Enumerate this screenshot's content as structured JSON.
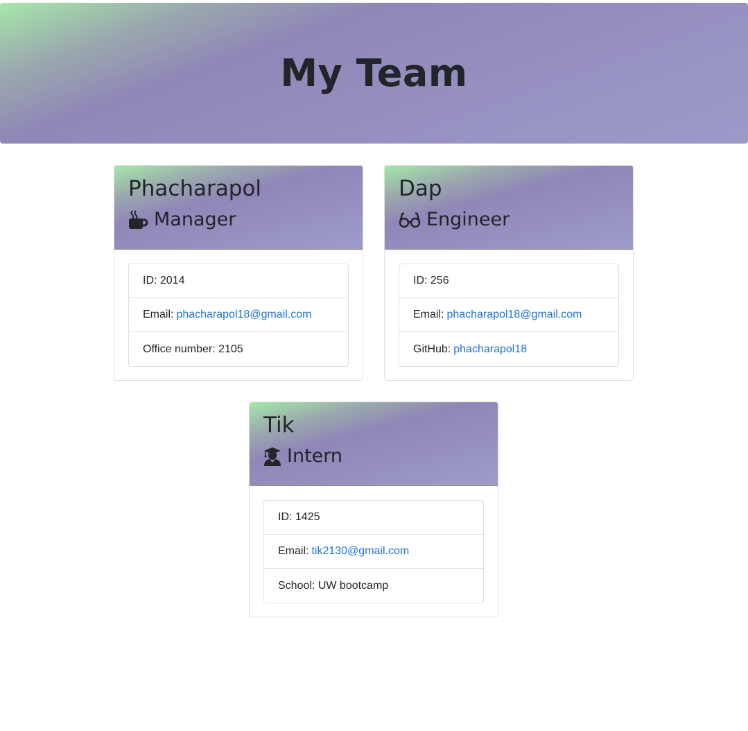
{
  "header": {
    "title": "My Team"
  },
  "cards": [
    {
      "name": "Phacharapol",
      "role": "Manager",
      "icon": "coffee-icon",
      "id_label": "ID: 2014",
      "email_label": "Email:",
      "email": "phacharapol18@gmail.com",
      "extra_label": "Office number: 2105"
    },
    {
      "name": "Dap",
      "role": "Engineer",
      "icon": "glasses-icon",
      "id_label": "ID: 256",
      "email_label": "Email:",
      "email": "phacharapol18@gmail.com",
      "extra_label": "GitHub:",
      "extra_link": "phacharapol18"
    },
    {
      "name": "Tik",
      "role": "Intern",
      "icon": "graduate-icon",
      "id_label": "ID: 1425",
      "email_label": "Email:",
      "email": "tik2130@gmail.com",
      "extra_label": "School: UW bootcamp"
    }
  ],
  "colors": {
    "gradient_green": "#a6e8a9",
    "gradient_purple": "#8f87b7",
    "link": "#1f73d6",
    "text": "#212529"
  }
}
